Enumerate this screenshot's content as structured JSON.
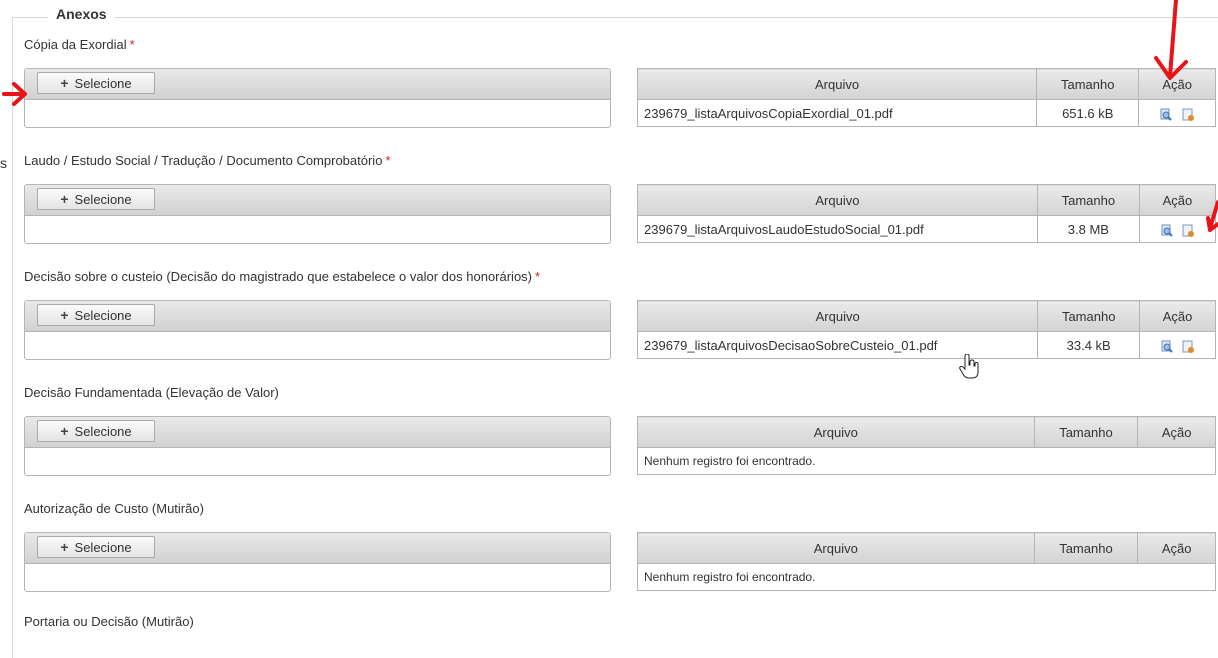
{
  "fieldset": {
    "legend": "Anexos"
  },
  "sections": [
    {
      "label": "Cópia da Exordial",
      "required": true,
      "select_label": "Selecione",
      "table": {
        "headers": [
          "Arquivo",
          "Tamanho",
          "Ação"
        ],
        "file_name": "239679_listaArquivosCopiaExordial_01.pdf",
        "file_size": "651.6 kB"
      }
    },
    {
      "label": "Laudo / Estudo Social / Tradução / Documento Comprobatório",
      "required": true,
      "select_label": "Selecione",
      "table": {
        "headers": [
          "Arquivo",
          "Tamanho",
          "Ação"
        ],
        "file_name": "239679_listaArquivosLaudoEstudoSocial_01.pdf",
        "file_size": "3.8 MB"
      }
    },
    {
      "label": "Decisão sobre o custeio (Decisão do magistrado que estabelece o valor dos honorários)",
      "required": true,
      "select_label": "Selecione",
      "table": {
        "headers": [
          "Arquivo",
          "Tamanho",
          "Ação"
        ],
        "file_name": "239679_listaArquivosDecisaoSobreCusteio_01.pdf",
        "file_size": "33.4 kB"
      }
    },
    {
      "label": "Decisão Fundamentada (Elevação de Valor)",
      "required": false,
      "select_label": "Selecione",
      "table": {
        "headers": [
          "Arquivo",
          "Tamanho",
          "Ação"
        ],
        "empty_text": "Nenhum registro foi encontrado."
      }
    },
    {
      "label": "Autorização de Custo (Mutirão)",
      "required": false,
      "select_label": "Selecione",
      "table": {
        "headers": [
          "Arquivo",
          "Tamanho",
          "Ação"
        ],
        "empty_text": "Nenhum registro foi encontrado."
      }
    },
    {
      "label": "Portaria ou Decisão (Mutirão)",
      "required": false
    }
  ],
  "required_marker": "*",
  "stray_text": "s",
  "icons": {
    "view": "magnifier-view-icon",
    "delete": "document-delete-icon",
    "add": "plus-icon",
    "cursor": "hand-pointer-cursor-icon",
    "annotation": "red-arrow-annotation"
  },
  "colors": {
    "annotation": "#e8141b",
    "required": "#cc2222",
    "view_icon": "#5a8fd0",
    "delete_icon": "#e08a2a"
  }
}
